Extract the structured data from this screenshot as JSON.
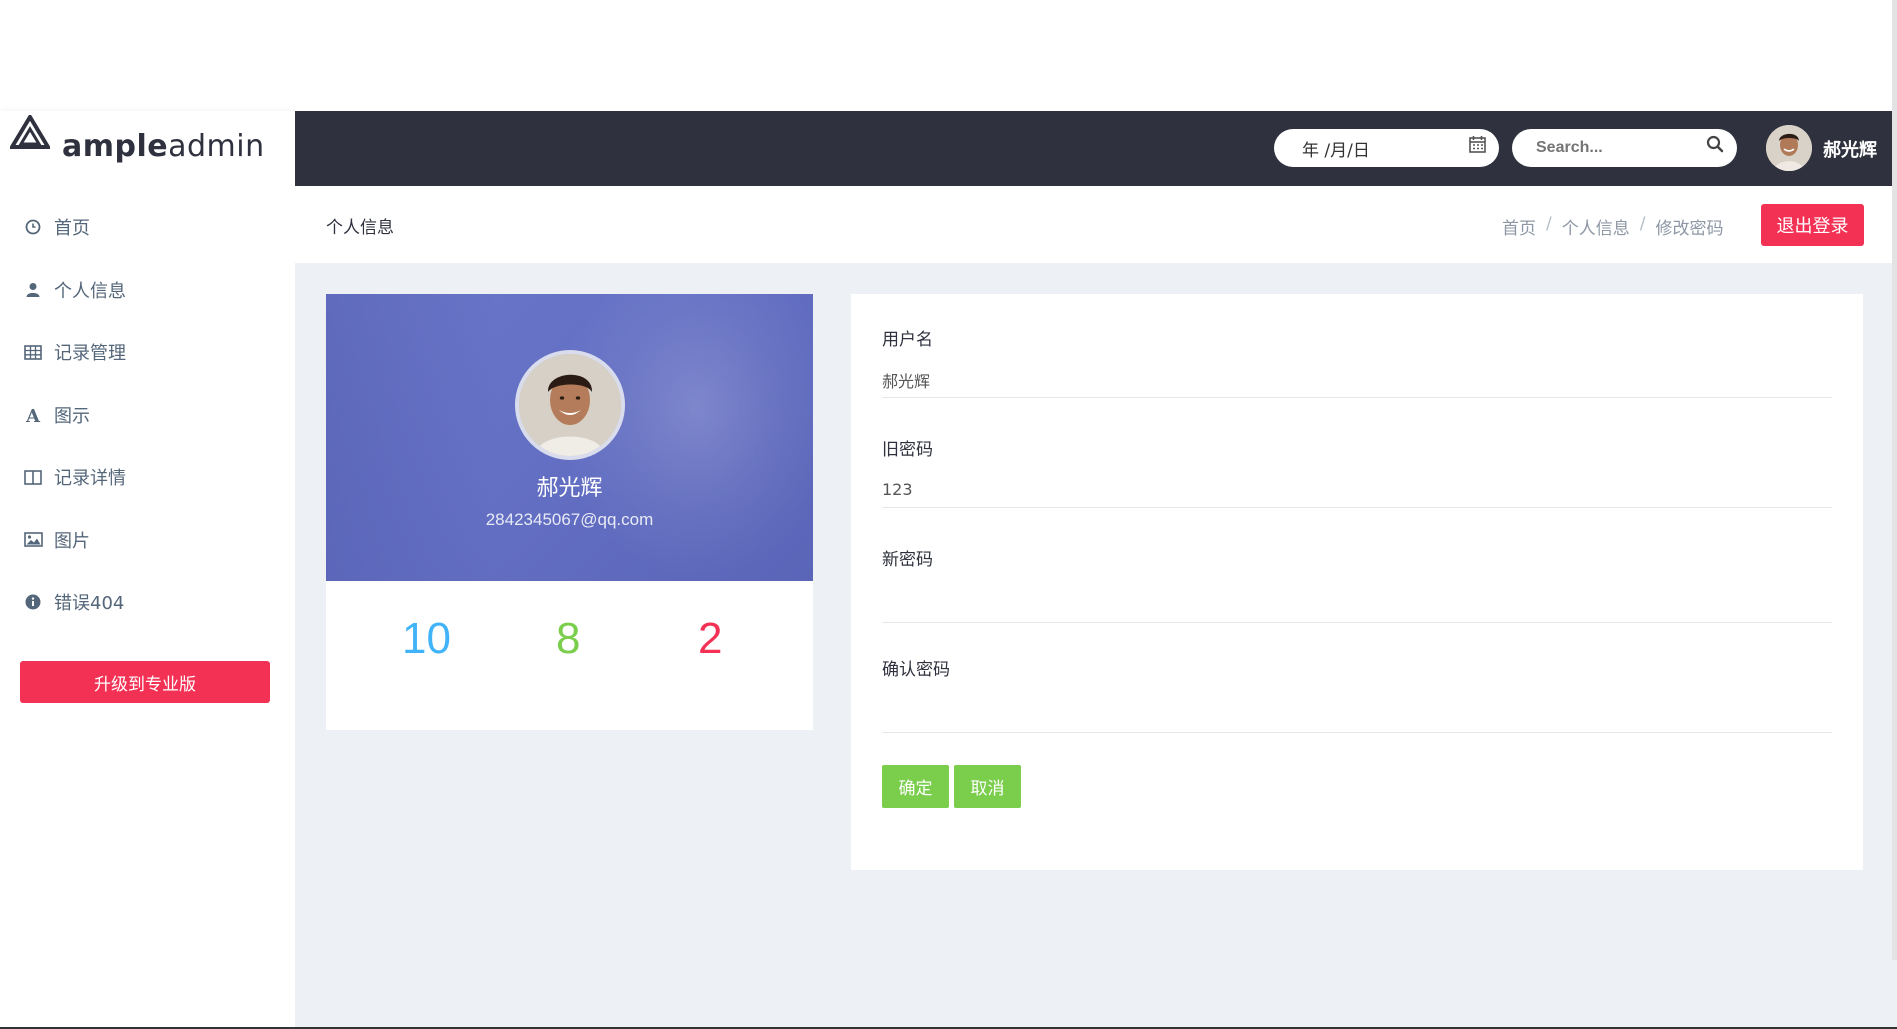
{
  "brand": {
    "bold": "ample",
    "thin": "admin"
  },
  "sidebar": {
    "items": [
      {
        "label": "首页",
        "icon": "clock-icon"
      },
      {
        "label": "个人信息",
        "icon": "user-icon"
      },
      {
        "label": "记录管理",
        "icon": "table-icon"
      },
      {
        "label": "图示",
        "icon": "font-icon"
      },
      {
        "label": "记录详情",
        "icon": "columns-icon"
      },
      {
        "label": "图片",
        "icon": "image-icon"
      },
      {
        "label": "错误404",
        "icon": "info-circle-icon"
      }
    ],
    "upgrade_label": "升级到专业版"
  },
  "topbar": {
    "date_value": "年 /月/日",
    "search_placeholder": "Search...",
    "user_name": "郝光辉"
  },
  "page": {
    "title": "个人信息",
    "breadcrumb": [
      "首页",
      "个人信息",
      "修改密码"
    ],
    "breadcrumb_sep": "/",
    "logout_label": "退出登录"
  },
  "profile": {
    "name": "郝光辉",
    "email": "2842345067@qq.com",
    "stats": [
      "10",
      "8",
      "2"
    ]
  },
  "form": {
    "username_label": "用户名",
    "username_value": "郝光辉",
    "old_password_label": "旧密码",
    "old_password_value": "123",
    "new_password_label": "新密码",
    "new_password_value": "",
    "confirm_password_label": "确认密码",
    "confirm_password_value": "",
    "confirm_button": "确定",
    "cancel_button": "取消"
  },
  "colors": {
    "accent_red": "#f33155",
    "accent_green": "#7ace4c",
    "accent_blue": "#41b3f9",
    "topbar_bg": "#2f323e",
    "banner_bg": "#6470c4"
  }
}
